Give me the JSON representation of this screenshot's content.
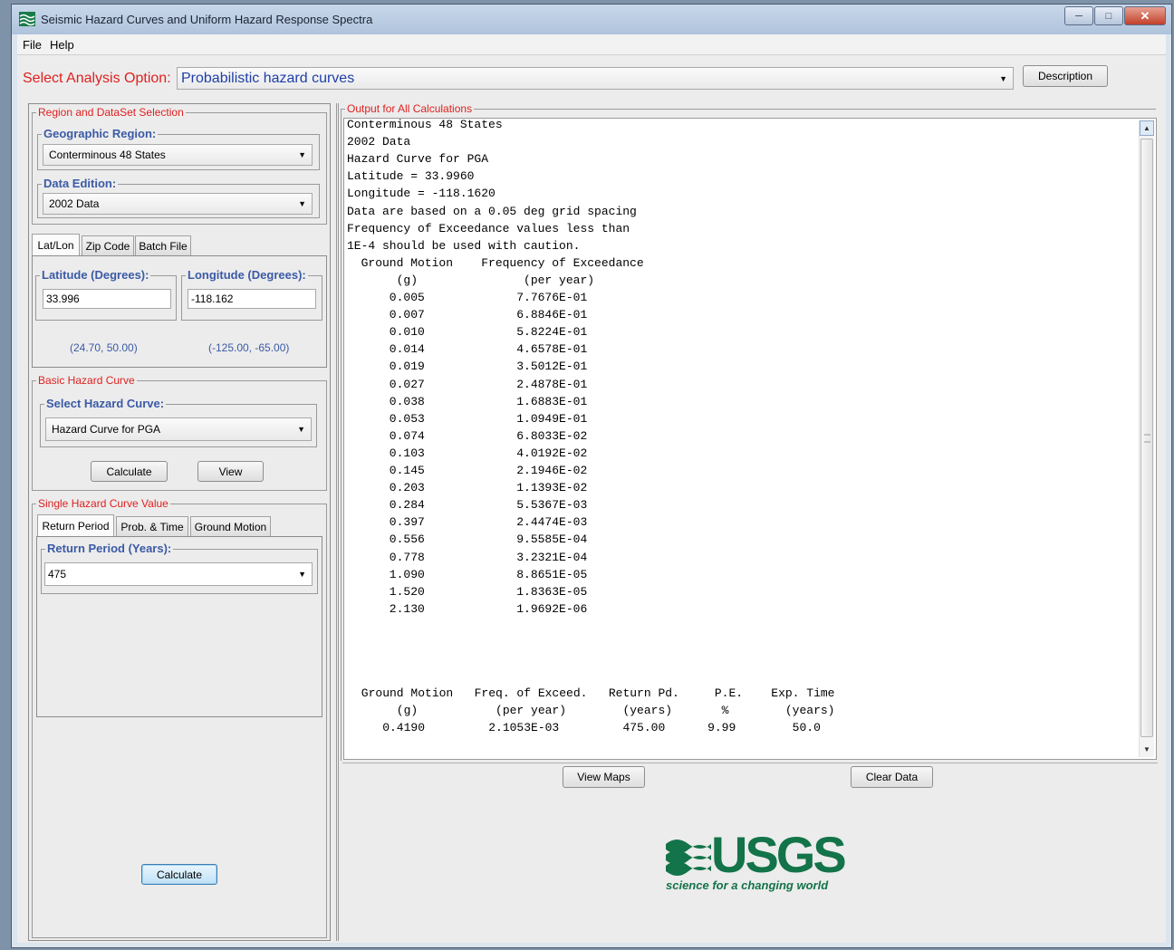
{
  "window": {
    "title": "Seismic Hazard Curves and Uniform Hazard Response Spectra"
  },
  "menu": {
    "file": "File",
    "help": "Help"
  },
  "analysis": {
    "label": "Select Analysis Option:",
    "selected": "Probabilistic hazard curves",
    "description_button": "Description"
  },
  "region": {
    "group_label": "Region and DataSet Selection",
    "geo_label": "Geographic Region:",
    "geo_value": "Conterminous 48 States",
    "edition_label": "Data Edition:",
    "edition_value": "2002 Data"
  },
  "location_tabs": [
    "Lat/Lon",
    "Zip Code",
    "Batch File"
  ],
  "latlon": {
    "lat_label": "Latitude (Degrees):",
    "lat_value": "33.996",
    "lon_label": "Longitude (Degrees):",
    "lon_value": "-118.162",
    "lat_range": "(24.70, 50.00)",
    "lon_range": "(-125.00, -65.00)"
  },
  "basic_curve": {
    "group_label": "Basic Hazard Curve",
    "select_label": "Select Hazard Curve:",
    "selected": "Hazard Curve for PGA",
    "calculate_button": "Calculate",
    "view_button": "View"
  },
  "single_value": {
    "group_label": "Single Hazard Curve Value",
    "tabs": [
      "Return Period",
      "Prob. & Time",
      "Ground Motion"
    ],
    "rp_label": "Return Period (Years):",
    "rp_value": "475",
    "calculate_button": "Calculate"
  },
  "output": {
    "group_label": "Output for All Calculations",
    "lines": [
      "Conterminous 48 States",
      "2002 Data",
      "Hazard Curve for PGA",
      "Latitude = 33.9960",
      "Longitude = -118.1620",
      "Data are based on a 0.05 deg grid spacing",
      "Frequency of Exceedance values less than",
      "1E-4 should be used with caution.",
      "  Ground Motion    Frequency of Exceedance",
      "       (g)               (per year)",
      "      0.005             7.7676E-01",
      "      0.007             6.8846E-01",
      "      0.010             5.8224E-01",
      "      0.014             4.6578E-01",
      "      0.019             3.5012E-01",
      "      0.027             2.4878E-01",
      "      0.038             1.6883E-01",
      "      0.053             1.0949E-01",
      "      0.074             6.8033E-02",
      "      0.103             4.0192E-02",
      "      0.145             2.1946E-02",
      "      0.203             1.1393E-02",
      "      0.284             5.5367E-03",
      "      0.397             2.4474E-03",
      "      0.556             9.5585E-04",
      "      0.778             3.2321E-04",
      "      1.090             8.8651E-05",
      "      1.520             1.8363E-05",
      "      2.130             1.9692E-06"
    ],
    "summary_lines": [
      " Ground Motion   Freq. of Exceed.   Return Pd.     P.E.    Exp. Time",
      "      (g)           (per year)        (years)       %        (years)",
      "    0.4190         2.1053E-03         475.00      9.99        50.0"
    ]
  },
  "bottom_buttons": {
    "view_maps": "View Maps",
    "clear_data": "Clear Data"
  },
  "logo": {
    "text": "USGS",
    "tagline": "science for a changing world",
    "color": "#137349"
  }
}
